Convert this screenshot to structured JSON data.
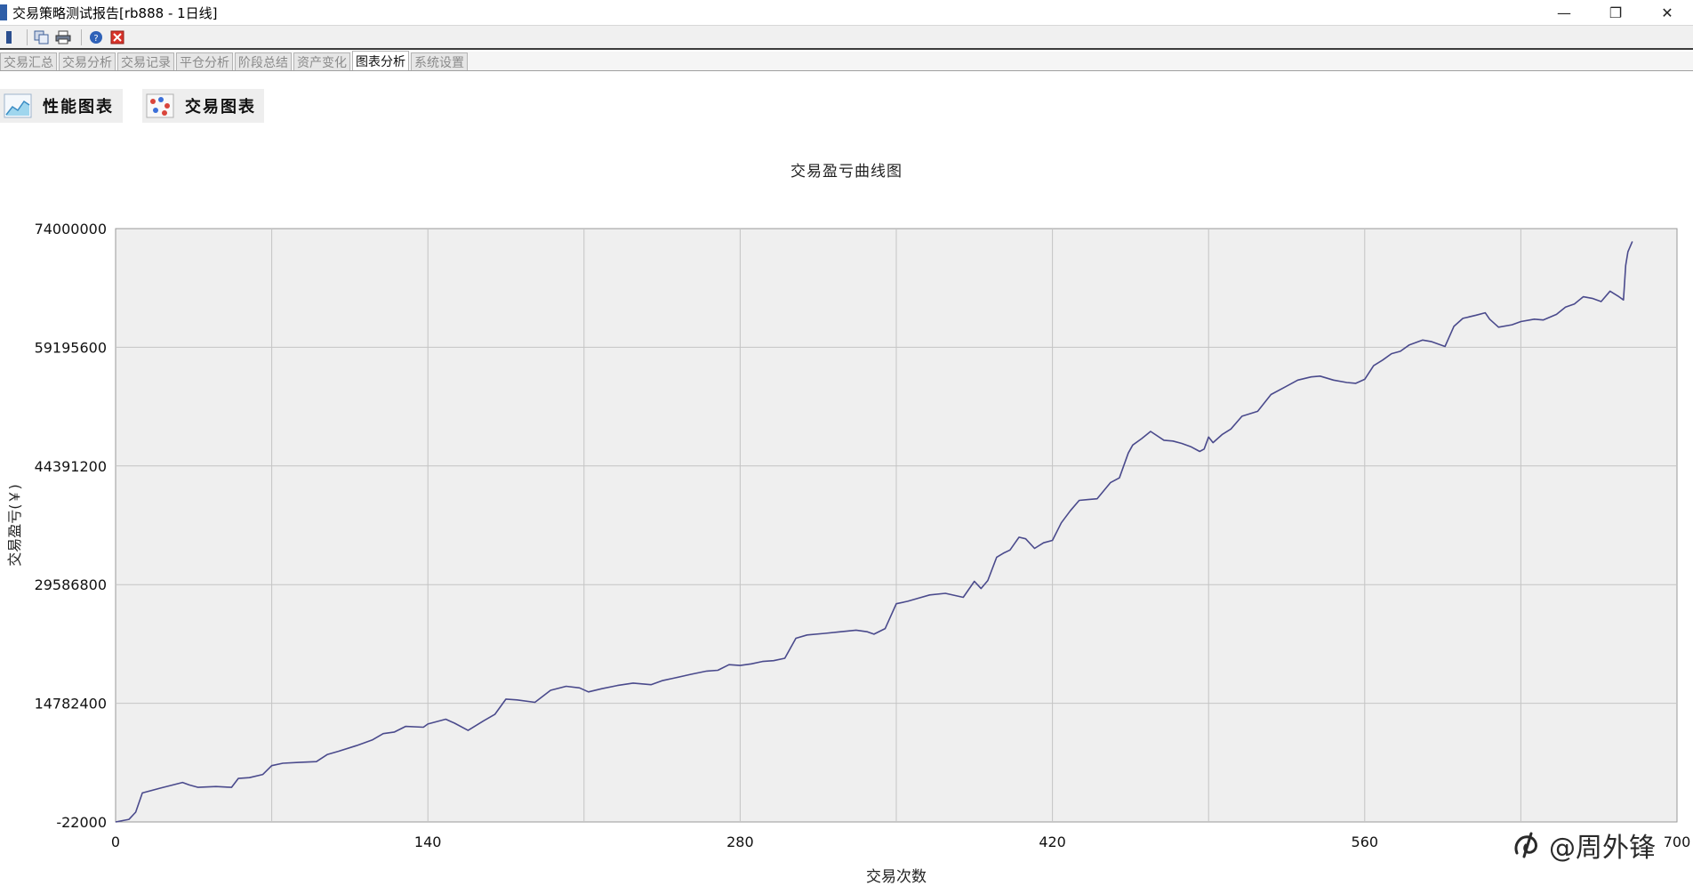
{
  "window": {
    "title": "交易策略测试报告[rb888 - 1日线]",
    "controls": [
      "—",
      "❐",
      "✕"
    ]
  },
  "toolbar": {
    "icons": [
      "save-icon",
      "copy-icon",
      "print-icon",
      "help-icon",
      "close-icon"
    ]
  },
  "tabs": [
    {
      "label": "交易汇总",
      "active": false
    },
    {
      "label": "交易分析",
      "active": false
    },
    {
      "label": "交易记录",
      "active": false
    },
    {
      "label": "平仓分析",
      "active": false
    },
    {
      "label": "阶段总结",
      "active": false
    },
    {
      "label": "资产变化",
      "active": false
    },
    {
      "label": "图表分析",
      "active": true
    },
    {
      "label": "系统设置",
      "active": false
    }
  ],
  "sub_buttons": {
    "performance": "性能图表",
    "trade": "交易图表"
  },
  "watermark": "@周外锋",
  "chart_data": {
    "type": "line",
    "title": "交易盈亏曲线图",
    "xlabel": "交易次数",
    "ylabel": "交易盈亏(￥)",
    "xlim": [
      0,
      700
    ],
    "ylim": [
      -22000,
      74000000
    ],
    "xticks": [
      "0",
      "140",
      "280",
      "420",
      "560",
      "700"
    ],
    "xtick_values": [
      0,
      140,
      280,
      420,
      560,
      700
    ],
    "yticks": [
      "74000000",
      "59195600",
      "44391200",
      "29586800",
      "14782400",
      "-22000"
    ],
    "ytick_values": [
      74000000,
      59195600,
      44391200,
      29586800,
      14782400,
      -22000
    ],
    "grid": true,
    "line_color": "#4a4a8c",
    "plot_bg": "#efefef",
    "series": [
      {
        "x": [
          0,
          6,
          9,
          12,
          20,
          30,
          33,
          37,
          45,
          52,
          55,
          60,
          66,
          70,
          75,
          82,
          90,
          95,
          100,
          108,
          115,
          120,
          125,
          130,
          138,
          140,
          148,
          152,
          158,
          165,
          170,
          175,
          180,
          188,
          195,
          202,
          208,
          212,
          218,
          225,
          232,
          240,
          245,
          250,
          258,
          265,
          270,
          275,
          280,
          285,
          290,
          295,
          300,
          305,
          310,
          318,
          325,
          332,
          337,
          340,
          345,
          350,
          355,
          360,
          365,
          372,
          380,
          385,
          388,
          391,
          395,
          398,
          401,
          405,
          408,
          412,
          416,
          420,
          424,
          428,
          432,
          436,
          440,
          446,
          450,
          454,
          456,
          460,
          464,
          470,
          474,
          478,
          482,
          486,
          488,
          490,
          492,
          496,
          500,
          505,
          512,
          518,
          524,
          530,
          536,
          540,
          546,
          552,
          556,
          560,
          564,
          568,
          572,
          576,
          580,
          586,
          590,
          596,
          600,
          604,
          610,
          614,
          616,
          620,
          626,
          630,
          636,
          640,
          646,
          650,
          654,
          658,
          662,
          666,
          670,
          674,
          676,
          677,
          678,
          680
        ],
        "values": [
          -22000,
          300000,
          1200000,
          3600000,
          4200000,
          4900000,
          4600000,
          4300000,
          4400000,
          4300000,
          5400000,
          5500000,
          5900000,
          7000000,
          7300000,
          7400000,
          7500000,
          8400000,
          8800000,
          9500000,
          10200000,
          11000000,
          11200000,
          11900000,
          11800000,
          12200000,
          12800000,
          12300000,
          11400000,
          12600000,
          13400000,
          15300000,
          15200000,
          14900000,
          16400000,
          16900000,
          16700000,
          16200000,
          16600000,
          17000000,
          17300000,
          17100000,
          17600000,
          17900000,
          18400000,
          18800000,
          18900000,
          19600000,
          19500000,
          19700000,
          20000000,
          20100000,
          20400000,
          22900000,
          23300000,
          23500000,
          23700000,
          23900000,
          23700000,
          23400000,
          24100000,
          27200000,
          27500000,
          27900000,
          28300000,
          28500000,
          28000000,
          30000000,
          29100000,
          30100000,
          33000000,
          33500000,
          33900000,
          35500000,
          35300000,
          34100000,
          34800000,
          35100000,
          37300000,
          38800000,
          40100000,
          40200000,
          40300000,
          42300000,
          42900000,
          46000000,
          47000000,
          47800000,
          48700000,
          47600000,
          47500000,
          47200000,
          46800000,
          46200000,
          46500000,
          48000000,
          47300000,
          48300000,
          49000000,
          50600000,
          51200000,
          53300000,
          54200000,
          55100000,
          55500000,
          55600000,
          55100000,
          54800000,
          54700000,
          55200000,
          56900000,
          57600000,
          58400000,
          58700000,
          59500000,
          60100000,
          59900000,
          59300000,
          61800000,
          62800000,
          63200000,
          63500000,
          62700000,
          61700000,
          62000000,
          62400000,
          62700000,
          62600000,
          63300000,
          64200000,
          64600000,
          65500000,
          65300000,
          64900000,
          66200000,
          65500000,
          65100000,
          69400000,
          71100000,
          72400000
        ]
      }
    ]
  }
}
